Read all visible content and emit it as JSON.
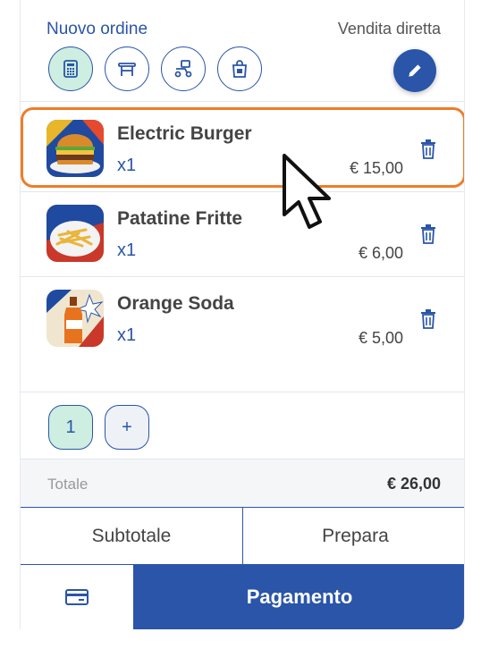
{
  "header": {
    "title": "Nuovo ordine",
    "mode": "Vendita diretta",
    "mode_buttons": [
      "register-icon",
      "table-icon",
      "delivery-icon",
      "takeaway-bag-icon"
    ],
    "edit_icon": "pencil-icon"
  },
  "items": [
    {
      "name": "Electric Burger",
      "qty": "x1",
      "price": "€ 15,00",
      "image": "burger"
    },
    {
      "name": "Patatine Fritte",
      "qty": "x1",
      "price": "€ 6,00",
      "image": "fries"
    },
    {
      "name": "Orange Soda",
      "qty": "x1",
      "price": "€ 5,00",
      "image": "soda"
    }
  ],
  "counter": {
    "value": "1",
    "add": "+"
  },
  "totals": {
    "label": "Totale",
    "value": "€ 26,00"
  },
  "actions": {
    "subtotal": "Subtotale",
    "prepare": "Prepara",
    "pay": "Pagamento"
  },
  "colors": {
    "accent": "#2a55a8",
    "highlight": "#ee7d2a",
    "active_bg": "#cdeee0"
  }
}
